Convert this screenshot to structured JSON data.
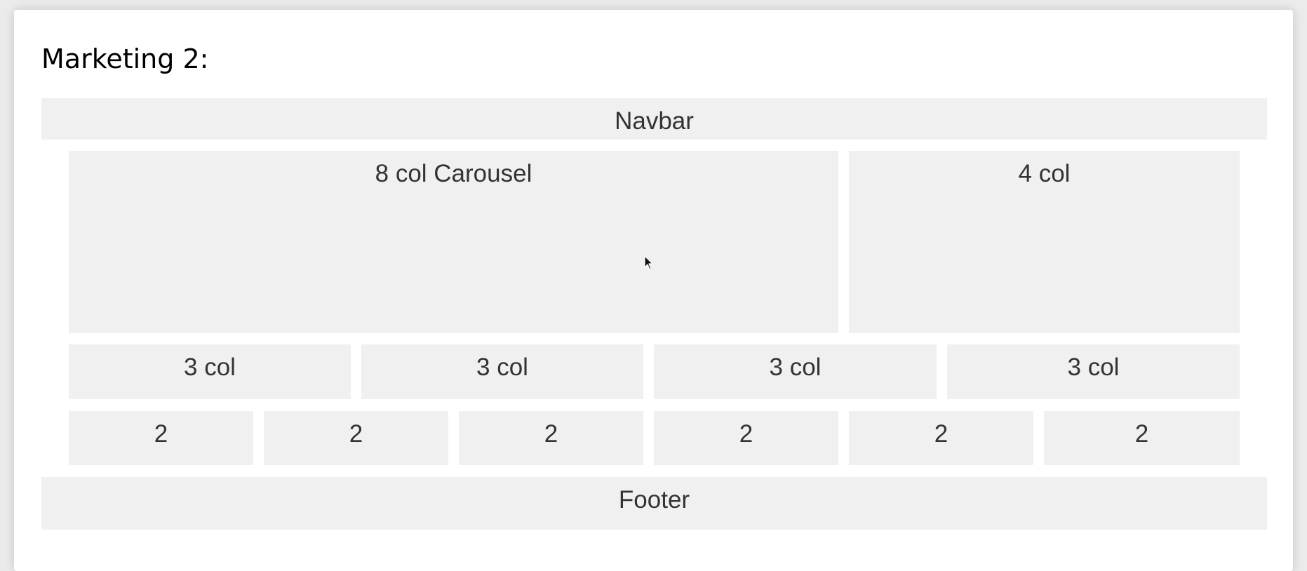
{
  "page": {
    "title": "Marketing 2:"
  },
  "layout": {
    "navbar": "Navbar",
    "carousel": "8 col Carousel",
    "side_col": "4 col",
    "row3": [
      "3 col",
      "3 col",
      "3 col",
      "3 col"
    ],
    "row2": [
      "2",
      "2",
      "2",
      "2",
      "2",
      "2"
    ],
    "footer": "Footer"
  },
  "colors": {
    "page_background": "#ebebeb",
    "card_background": "#ffffff",
    "block_background": "#f0f0f0",
    "block_text": "#333333"
  },
  "icons": {
    "pointer": "mouse-pointer-icon"
  }
}
